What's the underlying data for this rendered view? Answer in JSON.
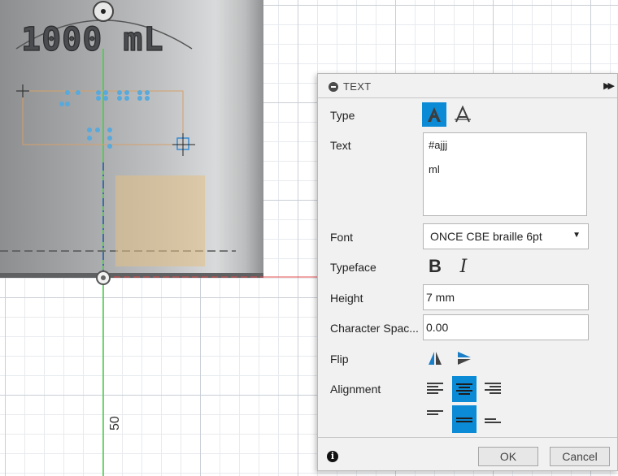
{
  "viewport": {
    "engraved_label": "1000 mL",
    "axis_tick_label": "50",
    "colors": {
      "grid_major": "#c9cfd6",
      "grid_minor": "#e7eaee",
      "green_axis": "#3fd23f",
      "red_axis": "#e24a4a",
      "braille_dots": "#58a9dc",
      "selection_box": "#d4a06a",
      "sketch_fill": "#e2bf83"
    }
  },
  "dialog": {
    "title": "TEXT",
    "type": {
      "label": "Type",
      "options": [
        "fill-text-icon",
        "outline-text-icon"
      ],
      "selected": 0
    },
    "text": {
      "label": "Text",
      "value_lines": [
        "#ajjj",
        "",
        "ml"
      ]
    },
    "font": {
      "label": "Font",
      "value": "ONCE CBE braille 6pt"
    },
    "typeface": {
      "label": "Typeface",
      "bold": "B",
      "italic": "I"
    },
    "height": {
      "label": "Height",
      "value": "7 mm"
    },
    "character_spacing": {
      "label": "Character Spac...",
      "value": "0.00"
    },
    "flip": {
      "label": "Flip"
    },
    "alignment": {
      "label": "Alignment",
      "horizontal_selected": "center",
      "vertical_selected": "middle"
    },
    "footer": {
      "ok": "OK",
      "cancel": "Cancel"
    },
    "accent": "#0b8ad6"
  }
}
